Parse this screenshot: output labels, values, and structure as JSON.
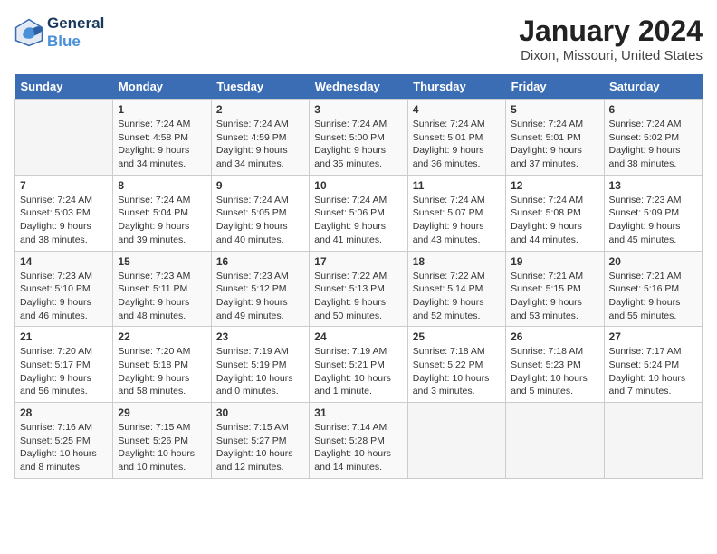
{
  "logo": {
    "line1": "General",
    "line2": "Blue"
  },
  "title": "January 2024",
  "subtitle": "Dixon, Missouri, United States",
  "days_of_week": [
    "Sunday",
    "Monday",
    "Tuesday",
    "Wednesday",
    "Thursday",
    "Friday",
    "Saturday"
  ],
  "weeks": [
    [
      {
        "day": "",
        "sunrise": "",
        "sunset": "",
        "daylight": "",
        "empty": true
      },
      {
        "day": "1",
        "sunrise": "Sunrise: 7:24 AM",
        "sunset": "Sunset: 4:58 PM",
        "daylight": "Daylight: 9 hours and 34 minutes."
      },
      {
        "day": "2",
        "sunrise": "Sunrise: 7:24 AM",
        "sunset": "Sunset: 4:59 PM",
        "daylight": "Daylight: 9 hours and 34 minutes."
      },
      {
        "day": "3",
        "sunrise": "Sunrise: 7:24 AM",
        "sunset": "Sunset: 5:00 PM",
        "daylight": "Daylight: 9 hours and 35 minutes."
      },
      {
        "day": "4",
        "sunrise": "Sunrise: 7:24 AM",
        "sunset": "Sunset: 5:01 PM",
        "daylight": "Daylight: 9 hours and 36 minutes."
      },
      {
        "day": "5",
        "sunrise": "Sunrise: 7:24 AM",
        "sunset": "Sunset: 5:01 PM",
        "daylight": "Daylight: 9 hours and 37 minutes."
      },
      {
        "day": "6",
        "sunrise": "Sunrise: 7:24 AM",
        "sunset": "Sunset: 5:02 PM",
        "daylight": "Daylight: 9 hours and 38 minutes."
      }
    ],
    [
      {
        "day": "7",
        "sunrise": "Sunrise: 7:24 AM",
        "sunset": "Sunset: 5:03 PM",
        "daylight": "Daylight: 9 hours and 38 minutes."
      },
      {
        "day": "8",
        "sunrise": "Sunrise: 7:24 AM",
        "sunset": "Sunset: 5:04 PM",
        "daylight": "Daylight: 9 hours and 39 minutes."
      },
      {
        "day": "9",
        "sunrise": "Sunrise: 7:24 AM",
        "sunset": "Sunset: 5:05 PM",
        "daylight": "Daylight: 9 hours and 40 minutes."
      },
      {
        "day": "10",
        "sunrise": "Sunrise: 7:24 AM",
        "sunset": "Sunset: 5:06 PM",
        "daylight": "Daylight: 9 hours and 41 minutes."
      },
      {
        "day": "11",
        "sunrise": "Sunrise: 7:24 AM",
        "sunset": "Sunset: 5:07 PM",
        "daylight": "Daylight: 9 hours and 43 minutes."
      },
      {
        "day": "12",
        "sunrise": "Sunrise: 7:24 AM",
        "sunset": "Sunset: 5:08 PM",
        "daylight": "Daylight: 9 hours and 44 minutes."
      },
      {
        "day": "13",
        "sunrise": "Sunrise: 7:23 AM",
        "sunset": "Sunset: 5:09 PM",
        "daylight": "Daylight: 9 hours and 45 minutes."
      }
    ],
    [
      {
        "day": "14",
        "sunrise": "Sunrise: 7:23 AM",
        "sunset": "Sunset: 5:10 PM",
        "daylight": "Daylight: 9 hours and 46 minutes."
      },
      {
        "day": "15",
        "sunrise": "Sunrise: 7:23 AM",
        "sunset": "Sunset: 5:11 PM",
        "daylight": "Daylight: 9 hours and 48 minutes."
      },
      {
        "day": "16",
        "sunrise": "Sunrise: 7:23 AM",
        "sunset": "Sunset: 5:12 PM",
        "daylight": "Daylight: 9 hours and 49 minutes."
      },
      {
        "day": "17",
        "sunrise": "Sunrise: 7:22 AM",
        "sunset": "Sunset: 5:13 PM",
        "daylight": "Daylight: 9 hours and 50 minutes."
      },
      {
        "day": "18",
        "sunrise": "Sunrise: 7:22 AM",
        "sunset": "Sunset: 5:14 PM",
        "daylight": "Daylight: 9 hours and 52 minutes."
      },
      {
        "day": "19",
        "sunrise": "Sunrise: 7:21 AM",
        "sunset": "Sunset: 5:15 PM",
        "daylight": "Daylight: 9 hours and 53 minutes."
      },
      {
        "day": "20",
        "sunrise": "Sunrise: 7:21 AM",
        "sunset": "Sunset: 5:16 PM",
        "daylight": "Daylight: 9 hours and 55 minutes."
      }
    ],
    [
      {
        "day": "21",
        "sunrise": "Sunrise: 7:20 AM",
        "sunset": "Sunset: 5:17 PM",
        "daylight": "Daylight: 9 hours and 56 minutes."
      },
      {
        "day": "22",
        "sunrise": "Sunrise: 7:20 AM",
        "sunset": "Sunset: 5:18 PM",
        "daylight": "Daylight: 9 hours and 58 minutes."
      },
      {
        "day": "23",
        "sunrise": "Sunrise: 7:19 AM",
        "sunset": "Sunset: 5:19 PM",
        "daylight": "Daylight: 10 hours and 0 minutes."
      },
      {
        "day": "24",
        "sunrise": "Sunrise: 7:19 AM",
        "sunset": "Sunset: 5:21 PM",
        "daylight": "Daylight: 10 hours and 1 minute."
      },
      {
        "day": "25",
        "sunrise": "Sunrise: 7:18 AM",
        "sunset": "Sunset: 5:22 PM",
        "daylight": "Daylight: 10 hours and 3 minutes."
      },
      {
        "day": "26",
        "sunrise": "Sunrise: 7:18 AM",
        "sunset": "Sunset: 5:23 PM",
        "daylight": "Daylight: 10 hours and 5 minutes."
      },
      {
        "day": "27",
        "sunrise": "Sunrise: 7:17 AM",
        "sunset": "Sunset: 5:24 PM",
        "daylight": "Daylight: 10 hours and 7 minutes."
      }
    ],
    [
      {
        "day": "28",
        "sunrise": "Sunrise: 7:16 AM",
        "sunset": "Sunset: 5:25 PM",
        "daylight": "Daylight: 10 hours and 8 minutes."
      },
      {
        "day": "29",
        "sunrise": "Sunrise: 7:15 AM",
        "sunset": "Sunset: 5:26 PM",
        "daylight": "Daylight: 10 hours and 10 minutes."
      },
      {
        "day": "30",
        "sunrise": "Sunrise: 7:15 AM",
        "sunset": "Sunset: 5:27 PM",
        "daylight": "Daylight: 10 hours and 12 minutes."
      },
      {
        "day": "31",
        "sunrise": "Sunrise: 7:14 AM",
        "sunset": "Sunset: 5:28 PM",
        "daylight": "Daylight: 10 hours and 14 minutes."
      },
      {
        "day": "",
        "sunrise": "",
        "sunset": "",
        "daylight": "",
        "empty": true
      },
      {
        "day": "",
        "sunrise": "",
        "sunset": "",
        "daylight": "",
        "empty": true
      },
      {
        "day": "",
        "sunrise": "",
        "sunset": "",
        "daylight": "",
        "empty": true
      }
    ]
  ]
}
